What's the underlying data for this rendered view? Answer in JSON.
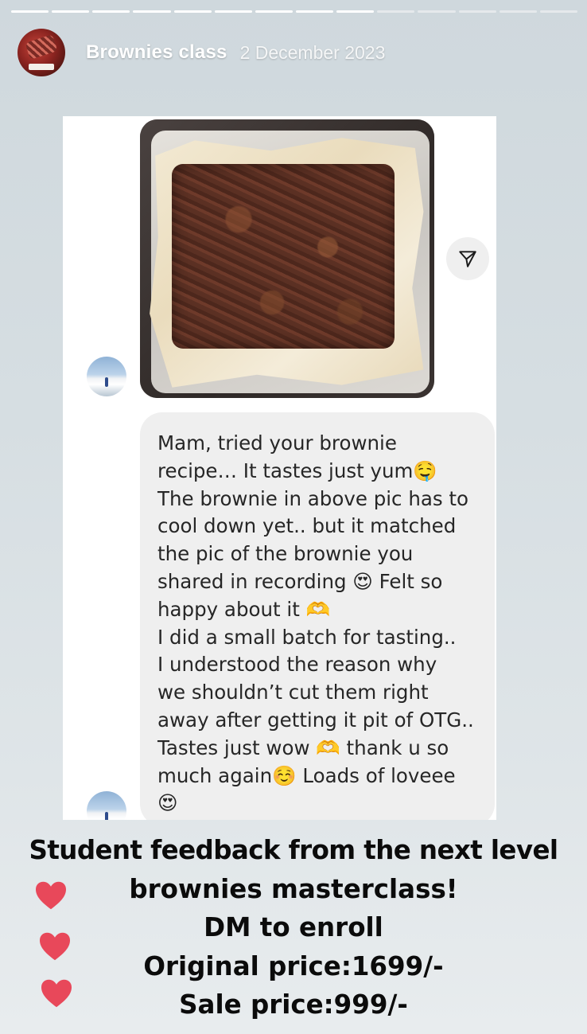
{
  "story": {
    "segments_total": 14,
    "segments_viewed": 9
  },
  "header": {
    "account_name": "Brownies class",
    "date": "2 December 2023",
    "avatar_icon": "brownie-profile-icon"
  },
  "chat": {
    "photo_description_icon": "brownie-tray-photo",
    "share_icon": "send-paper-plane-icon",
    "message_lines": [
      "Mam, tried your brownie",
      "recipe… It tastes just yum🤤",
      "The brownie in above pic has to",
      "cool down yet.. but it matched",
      "the pic of the brownie you",
      "shared in recording 😍 Felt so",
      "happy about it 🫶",
      "I did a small batch for tasting..",
      "I understood the reason why",
      "we shouldn’t cut them right",
      "away after getting it pit of OTG..",
      "Tastes just wow 🫶 thank u so",
      "much again☺️ Loads of loveee",
      "😍"
    ]
  },
  "caption": {
    "line1": "Student feedback from the next level",
    "line2": "brownies masterclass!",
    "line3": "DM to enroll",
    "line4": "Original price:1699/-",
    "line5": "Sale price:999/-"
  },
  "colors": {
    "heart": "#e8485a",
    "caption_text": "#0b0b0b",
    "bubble_bg": "#efefef"
  }
}
